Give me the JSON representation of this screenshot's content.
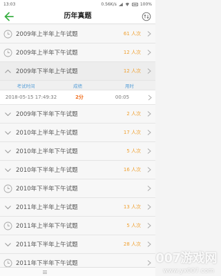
{
  "status_bar": {
    "time": "13:03",
    "speed": "0.56K/s",
    "battery": "100%"
  },
  "header": {
    "title": "历年真题"
  },
  "years": [
    {
      "name": "2009年上半年上午试题",
      "count": "61 人次",
      "icon": "clock-icon",
      "open": false
    },
    {
      "name": "2009年上半年下午试题",
      "count": "12 人次",
      "icon": "clock-icon",
      "open": false
    },
    {
      "name": "2009年下半年上午试题",
      "count": "12 人次",
      "icon": "chevron-up-icon",
      "open": true
    }
  ],
  "detail": {
    "headers": {
      "time": "考试时间",
      "score": "成绩",
      "duration": "用时"
    },
    "row": {
      "time": "2018-05-15 17:49:32",
      "score": "2分",
      "duration": "00:05"
    }
  },
  "years_after": [
    {
      "name": "2009年下半年下午试题",
      "count": "2 人次",
      "icon": "chevron-down-icon"
    },
    {
      "name": "2010年上半年上午试题",
      "count": "17 人次",
      "icon": "chevron-down-icon"
    },
    {
      "name": "2010年上半年下午试题",
      "count": "5 人次",
      "icon": "chevron-down-icon"
    },
    {
      "name": "2010年下半年上午试题",
      "count": "16 人次",
      "icon": "chevron-down-icon"
    },
    {
      "name": "2010年下半年下午试题",
      "count": "",
      "icon": "clock-icon"
    },
    {
      "name": "2011年上半年上午试题",
      "count": "13 人次",
      "icon": "chevron-down-icon"
    },
    {
      "name": "2011年上半年下午试题",
      "count": "5 人次",
      "icon": "clock-icon"
    },
    {
      "name": "2011年下半年上午试题",
      "count": "28 人次",
      "icon": "chevron-down-icon"
    },
    {
      "name": "2011年下半年下午试题",
      "count": "",
      "icon": "clock-icon"
    }
  ],
  "watermark": {
    "brand": "007游戏网",
    "url": "www.yx007.com"
  },
  "colors": {
    "accent_green": "#3cb045",
    "count_orange": "#f0a030",
    "score_orange": "#f07020",
    "detail_blue": "#5aa0d8"
  }
}
